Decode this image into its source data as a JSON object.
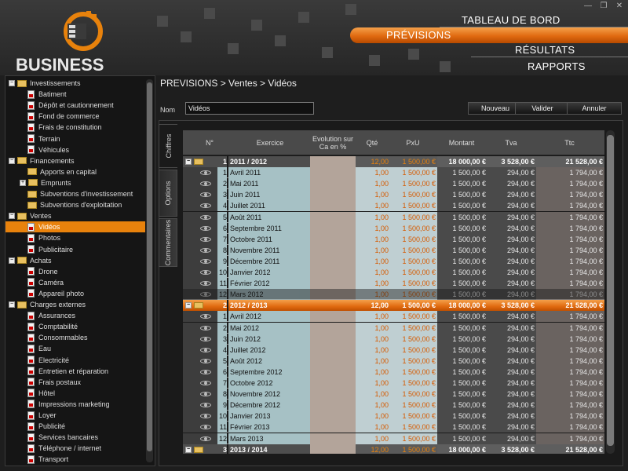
{
  "app": {
    "title": "BUSINESS PLAN"
  },
  "window": {
    "minimize": "—",
    "restore": "❐",
    "close": "✕"
  },
  "nav": {
    "tableau": "TABLEAU DE BORD",
    "previsions": "PRÉVISIONS",
    "resultats": "RÉSULTATS",
    "rapports": "RAPPORTS"
  },
  "sidebar": [
    {
      "label": "Investissements",
      "kind": "group",
      "level": 0
    },
    {
      "label": "Batiment",
      "kind": "doc",
      "level": 1
    },
    {
      "label": "Dépôt et cautionnement",
      "kind": "doc",
      "level": 1
    },
    {
      "label": "Fond de commerce",
      "kind": "doc",
      "level": 1
    },
    {
      "label": "Frais de constitution",
      "kind": "doc",
      "level": 1
    },
    {
      "label": "Terrain",
      "kind": "doc",
      "level": 1
    },
    {
      "label": "Véhicules",
      "kind": "doc",
      "level": 1
    },
    {
      "label": "Financements",
      "kind": "group",
      "level": 0
    },
    {
      "label": "Apports en capital",
      "kind": "folder",
      "level": 1
    },
    {
      "label": "Emprunts",
      "kind": "folderexp",
      "level": 1
    },
    {
      "label": "Subventions d'investissement",
      "kind": "folder",
      "level": 1
    },
    {
      "label": "Subventions d'exploitation",
      "kind": "folder",
      "level": 1
    },
    {
      "label": "Ventes",
      "kind": "group",
      "level": 0
    },
    {
      "label": "Vidéos",
      "kind": "doc",
      "level": 1,
      "selected": true
    },
    {
      "label": "Photos",
      "kind": "doc",
      "level": 1
    },
    {
      "label": "Publicitaire",
      "kind": "doc",
      "level": 1
    },
    {
      "label": "Achats",
      "kind": "group",
      "level": 0
    },
    {
      "label": "Drone",
      "kind": "doc",
      "level": 1
    },
    {
      "label": "Caméra",
      "kind": "doc",
      "level": 1
    },
    {
      "label": "Appareil photo",
      "kind": "doc",
      "level": 1
    },
    {
      "label": "Charges externes",
      "kind": "group",
      "level": 0
    },
    {
      "label": "Assurances",
      "kind": "doc",
      "level": 1
    },
    {
      "label": "Comptabilité",
      "kind": "doc",
      "level": 1
    },
    {
      "label": "Consommables",
      "kind": "doc",
      "level": 1
    },
    {
      "label": "Eau",
      "kind": "doc",
      "level": 1
    },
    {
      "label": "Electricité",
      "kind": "doc",
      "level": 1
    },
    {
      "label": "Entretien et réparation",
      "kind": "doc",
      "level": 1
    },
    {
      "label": "Frais postaux",
      "kind": "doc",
      "level": 1
    },
    {
      "label": "Hôtel",
      "kind": "doc",
      "level": 1
    },
    {
      "label": "Impressions marketing",
      "kind": "doc",
      "level": 1
    },
    {
      "label": "Loyer",
      "kind": "doc",
      "level": 1
    },
    {
      "label": "Publicité",
      "kind": "doc",
      "level": 1
    },
    {
      "label": "Services bancaires",
      "kind": "doc",
      "level": 1
    },
    {
      "label": "Téléphone / internet",
      "kind": "doc",
      "level": 1
    },
    {
      "label": "Transport",
      "kind": "doc",
      "level": 1
    }
  ],
  "breadcrumb": "PREVISIONS > Ventes > Vidéos",
  "form": {
    "nom_label": "Nom",
    "nom_value": "Vidéos"
  },
  "buttons": {
    "nouveau": "Nouveau",
    "valider": "Valider",
    "annuler": "Annuler"
  },
  "vtabs": {
    "chiffres": "Chiffres",
    "options": "Options",
    "commentaires": "Commentaires"
  },
  "columns": {
    "num": "N°",
    "exercice": "Exercice",
    "evolution": "Evolution sur Ca en %",
    "qte": "Qté",
    "pxu": "PxU",
    "montant": "Montant",
    "tva": "Tva",
    "ttc": "Ttc"
  },
  "rows": [
    {
      "type": "group",
      "num": "1",
      "ex": "2011 / 2012",
      "qte": "12,00",
      "pxu": "1 500,00 €",
      "mont": "18 000,00 €",
      "tva": "3 528,00 €",
      "ttc": "21 528,00 €"
    },
    {
      "type": "detail",
      "num": "1",
      "ex": "Avril 2011",
      "qte": "1,00",
      "pxu": "1 500,00 €",
      "mont": "1 500,00 €",
      "tva": "294,00 €",
      "ttc": "1 794,00 €"
    },
    {
      "type": "detail",
      "num": "2",
      "ex": "Mai 2011",
      "qte": "1,00",
      "pxu": "1 500,00 €",
      "mont": "1 500,00 €",
      "tva": "294,00 €",
      "ttc": "1 794,00 €"
    },
    {
      "type": "detail",
      "num": "3",
      "ex": "Juin 2011",
      "qte": "1,00",
      "pxu": "1 500,00 €",
      "mont": "1 500,00 €",
      "tva": "294,00 €",
      "ttc": "1 794,00 €"
    },
    {
      "type": "detail",
      "num": "4",
      "ex": "Juillet 2011",
      "qte": "1,00",
      "pxu": "1 500,00 €",
      "mont": "1 500,00 €",
      "tva": "294,00 €",
      "ttc": "1 794,00 €"
    },
    {
      "type": "detail",
      "num": "5",
      "ex": "Août 2011",
      "qte": "1,00",
      "pxu": "1 500,00 €",
      "mont": "1 500,00 €",
      "tva": "294,00 €",
      "ttc": "1 794,00 €"
    },
    {
      "type": "detail",
      "num": "6",
      "ex": "Septembre 2011",
      "qte": "1,00",
      "pxu": "1 500,00 €",
      "mont": "1 500,00 €",
      "tva": "294,00 €",
      "ttc": "1 794,00 €"
    },
    {
      "type": "detail",
      "num": "7",
      "ex": "Octobre 2011",
      "qte": "1,00",
      "pxu": "1 500,00 €",
      "mont": "1 500,00 €",
      "tva": "294,00 €",
      "ttc": "1 794,00 €"
    },
    {
      "type": "detail",
      "num": "8",
      "ex": "Novembre 2011",
      "qte": "1,00",
      "pxu": "1 500,00 €",
      "mont": "1 500,00 €",
      "tva": "294,00 €",
      "ttc": "1 794,00 €"
    },
    {
      "type": "detail",
      "num": "9",
      "ex": "Décembre 2011",
      "qte": "1,00",
      "pxu": "1 500,00 €",
      "mont": "1 500,00 €",
      "tva": "294,00 €",
      "ttc": "1 794,00 €"
    },
    {
      "type": "detail",
      "num": "10",
      "ex": "Janvier 2012",
      "qte": "1,00",
      "pxu": "1 500,00 €",
      "mont": "1 500,00 €",
      "tva": "294,00 €",
      "ttc": "1 794,00 €"
    },
    {
      "type": "detail",
      "num": "11",
      "ex": "Février 2012",
      "qte": "1,00",
      "pxu": "1 500,00 €",
      "mont": "1 500,00 €",
      "tva": "294,00 €",
      "ttc": "1 794,00 €"
    },
    {
      "type": "detail",
      "num": "12",
      "ex": "Mars 2012",
      "qte": "1,00",
      "pxu": "1 500,00 €",
      "mont": "1 500,00 €",
      "tva": "294,00 €",
      "ttc": "1 794,00 €",
      "dim": true
    },
    {
      "type": "group",
      "num": "2",
      "ex": "2012 / 2013",
      "qte": "12,00",
      "pxu": "1 500,00 €",
      "mont": "18 000,00 €",
      "tva": "3 528,00 €",
      "ttc": "21 528,00 €",
      "selected": true
    },
    {
      "type": "detail",
      "num": "1",
      "ex": "Avril 2012",
      "qte": "1,00",
      "pxu": "1 500,00 €",
      "mont": "1 500,00 €",
      "tva": "294,00 €",
      "ttc": "1 794,00 €"
    },
    {
      "type": "detail",
      "num": "2",
      "ex": "Mai 2012",
      "qte": "1,00",
      "pxu": "1 500,00 €",
      "mont": "1 500,00 €",
      "tva": "294,00 €",
      "ttc": "1 794,00 €"
    },
    {
      "type": "detail",
      "num": "3",
      "ex": "Juin 2012",
      "qte": "1,00",
      "pxu": "1 500,00 €",
      "mont": "1 500,00 €",
      "tva": "294,00 €",
      "ttc": "1 794,00 €"
    },
    {
      "type": "detail",
      "num": "4",
      "ex": "Juillet 2012",
      "qte": "1,00",
      "pxu": "1 500,00 €",
      "mont": "1 500,00 €",
      "tva": "294,00 €",
      "ttc": "1 794,00 €"
    },
    {
      "type": "detail",
      "num": "5",
      "ex": "Août 2012",
      "qte": "1,00",
      "pxu": "1 500,00 €",
      "mont": "1 500,00 €",
      "tva": "294,00 €",
      "ttc": "1 794,00 €"
    },
    {
      "type": "detail",
      "num": "6",
      "ex": "Septembre 2012",
      "qte": "1,00",
      "pxu": "1 500,00 €",
      "mont": "1 500,00 €",
      "tva": "294,00 €",
      "ttc": "1 794,00 €"
    },
    {
      "type": "detail",
      "num": "7",
      "ex": "Octobre 2012",
      "qte": "1,00",
      "pxu": "1 500,00 €",
      "mont": "1 500,00 €",
      "tva": "294,00 €",
      "ttc": "1 794,00 €"
    },
    {
      "type": "detail",
      "num": "8",
      "ex": "Novembre 2012",
      "qte": "1,00",
      "pxu": "1 500,00 €",
      "mont": "1 500,00 €",
      "tva": "294,00 €",
      "ttc": "1 794,00 €"
    },
    {
      "type": "detail",
      "num": "9",
      "ex": "Décembre 2012",
      "qte": "1,00",
      "pxu": "1 500,00 €",
      "mont": "1 500,00 €",
      "tva": "294,00 €",
      "ttc": "1 794,00 €"
    },
    {
      "type": "detail",
      "num": "10",
      "ex": "Janvier 2013",
      "qte": "1,00",
      "pxu": "1 500,00 €",
      "mont": "1 500,00 €",
      "tva": "294,00 €",
      "ttc": "1 794,00 €"
    },
    {
      "type": "detail",
      "num": "11",
      "ex": "Février 2013",
      "qte": "1,00",
      "pxu": "1 500,00 €",
      "mont": "1 500,00 €",
      "tva": "294,00 €",
      "ttc": "1 794,00 €"
    },
    {
      "type": "detail",
      "num": "12",
      "ex": "Mars 2013",
      "qte": "1,00",
      "pxu": "1 500,00 €",
      "mont": "1 500,00 €",
      "tva": "294,00 €",
      "ttc": "1 794,00 €"
    },
    {
      "type": "group",
      "num": "3",
      "ex": "2013 / 2014",
      "qte": "12,00",
      "pxu": "1 500,00 €",
      "mont": "18 000,00 €",
      "tva": "3 528,00 €",
      "ttc": "21 528,00 €"
    }
  ],
  "colors": {
    "accent": "#e8820c",
    "header_bg": "#2e2e2e"
  }
}
